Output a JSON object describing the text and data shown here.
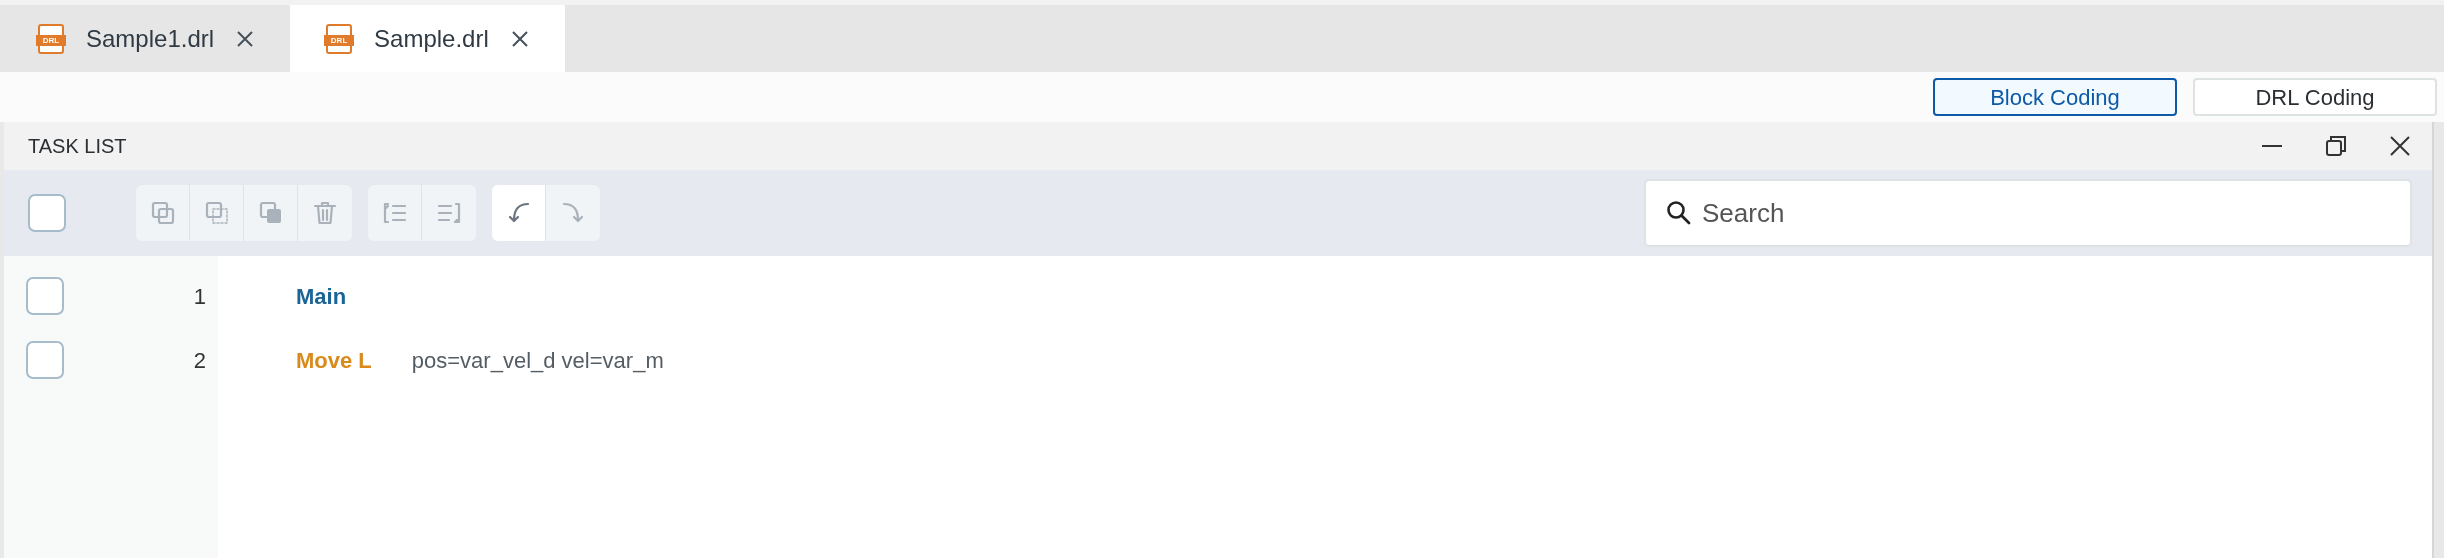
{
  "tabs": [
    {
      "label": "Sample1.drl",
      "icon_text": "DRL",
      "selected": false
    },
    {
      "label": "Sample.drl",
      "icon_text": "DRL",
      "selected": true
    }
  ],
  "mode_buttons": [
    {
      "label": "Block Coding",
      "selected": true
    },
    {
      "label": "DRL Coding",
      "selected": false
    }
  ],
  "panel": {
    "title": "TASK LIST",
    "select_all": {
      "checked": false
    },
    "tool_groups": [
      [
        {
          "kind": "copy",
          "disabled": true
        },
        {
          "kind": "cut",
          "disabled": true
        },
        {
          "kind": "paste",
          "disabled": true
        },
        {
          "kind": "delete",
          "disabled": true
        }
      ],
      [
        {
          "kind": "indent",
          "disabled": true
        },
        {
          "kind": "outdent",
          "disabled": true
        }
      ],
      [
        {
          "kind": "undo",
          "disabled": false
        },
        {
          "kind": "redo",
          "disabled": true
        }
      ]
    ],
    "search": {
      "placeholder": "Search"
    },
    "rows": [
      {
        "number": "1",
        "command": "Main",
        "color": "#1a6496",
        "checked": false
      },
      {
        "number": "2",
        "command": "Move L",
        "params": "pos=var_vel_d vel=var_m",
        "color": "#d98a1c",
        "checked": false
      }
    ]
  }
}
